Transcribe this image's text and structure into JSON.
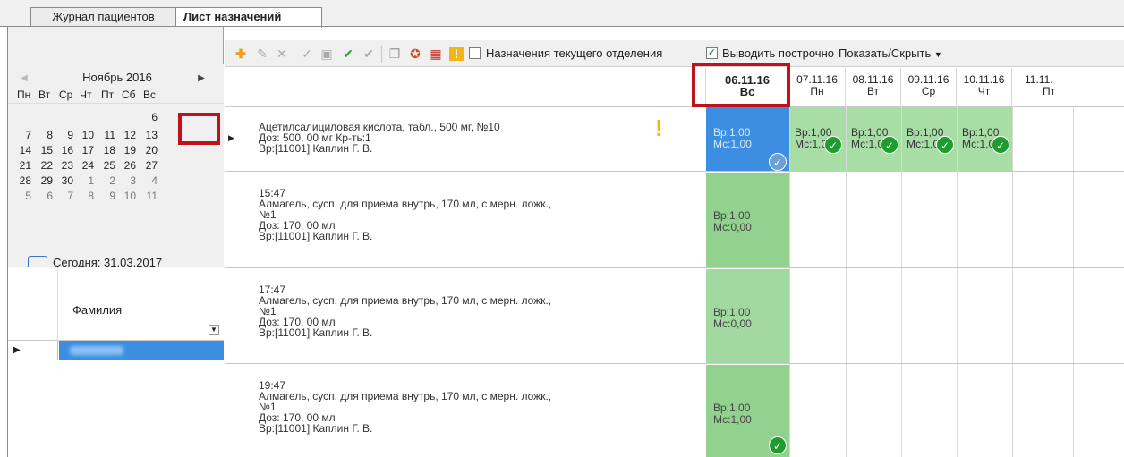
{
  "tabs": [
    {
      "label": "Журнал пациентов"
    },
    {
      "label": "Лист назначений"
    }
  ],
  "calendar": {
    "month": "Ноябрь 2016",
    "weekdays": [
      "Пн",
      "Вт",
      "Ср",
      "Чт",
      "Пт",
      "Сб",
      "Вс"
    ],
    "weeks": [
      [
        "",
        "",
        "",
        "",
        "",
        "",
        "6"
      ],
      [
        "7",
        "8",
        "9",
        "10",
        "11",
        "12",
        "13"
      ],
      [
        "14",
        "15",
        "16",
        "17",
        "18",
        "19",
        "20"
      ],
      [
        "21",
        "22",
        "23",
        "24",
        "25",
        "26",
        "27"
      ],
      [
        "28",
        "29",
        "30",
        "1",
        "2",
        "3",
        "4"
      ],
      [
        "5",
        "6",
        "7",
        "8",
        "9",
        "10",
        "11"
      ]
    ],
    "selected_day": "6",
    "today_label": "Сегодня: 31.03.2017",
    "highlight_color": "#c0111c"
  },
  "patients": {
    "column_header": "Фамилия"
  },
  "toolbar": {
    "icons": [
      "add-icon",
      "edit-icon",
      "delete-icon",
      "check-icon",
      "sign-icon",
      "approve-icon",
      "cancel-approve-icon",
      "copy-icon",
      "print-icon",
      "calendar-icon",
      "warning-icon"
    ],
    "checkbox_dept_label": "Назначения текущего отделения",
    "checkbox_dept_checked": false,
    "checkbox_rowwise_label": "Выводить построчно",
    "checkbox_rowwise_checked": true,
    "showhide_label": "Показать/Скрыть"
  },
  "dates": [
    {
      "date": "06.11.16",
      "dow": "Вс"
    },
    {
      "date": "07.11.16",
      "dow": "Пн"
    },
    {
      "date": "08.11.16",
      "dow": "Вт"
    },
    {
      "date": "09.11.16",
      "dow": "Ср"
    },
    {
      "date": "10.11.16",
      "dow": "Чт"
    },
    {
      "date": "11.11.",
      "dow": "Пт"
    }
  ],
  "rows": [
    {
      "lines": [
        "Ацетилсалициловая кислота, табл., 500 мг, №10",
        "Доз: 500, 00 мг Кр-ть:1",
        "Вр:[11001] Каплин Г. В."
      ],
      "cells": [
        {
          "line1": "Вр:1,00",
          "line2": "Мс:1,00"
        },
        {
          "line1": "Вр:1,00",
          "line2": "Мс:1,00"
        },
        {
          "line1": "Вр:1,00",
          "line2": "Мс:1,00"
        },
        {
          "line1": "Вр:1,00",
          "line2": "Мс:1,00"
        },
        {
          "line1": "Вр:1,00",
          "line2": "Мс:1,00"
        }
      ]
    },
    {
      "lines": [
        "15:47",
        "Алмагель, сусп. для приема внутрь, 170 мл, с мерн. ложк.,",
        "№1",
        "Доз: 170, 00 мл",
        "Вр:[11001] Каплин Г. В."
      ],
      "cells": [
        {
          "line1": "Вр:1,00",
          "line2": "Мс:0,00"
        }
      ]
    },
    {
      "lines": [
        "17:47",
        "Алмагель, сусп. для приема внутрь, 170 мл, с мерн. ложк.,",
        "№1",
        "Доз: 170, 00 мл",
        "Вр:[11001] Каплин Г. В."
      ],
      "cells": [
        {
          "line1": "Вр:1,00",
          "line2": "Мс:0,00"
        }
      ]
    },
    {
      "lines": [
        "19:47",
        "Алмагель, сусп. для приема внутрь, 170 мл, с мерн. ложк.,",
        "№1",
        "Доз: 170, 00 мл",
        "Вр:[11001] Каплин Г. В."
      ],
      "cells": [
        {
          "line1": "Вр:1,00",
          "line2": "Мс:1,00"
        }
      ]
    }
  ]
}
